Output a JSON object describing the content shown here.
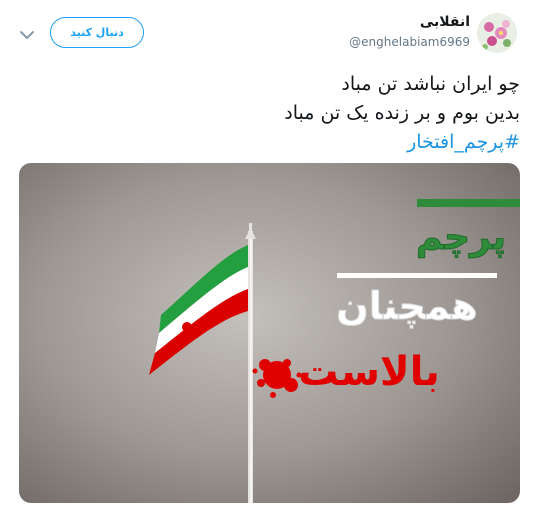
{
  "tweet": {
    "display_name": "انقلابی",
    "handle": "@enghelabiam6969",
    "follow_label": "دنبال کنید",
    "text_line1": "چو ایران نباشد تن مباد",
    "text_line2": "بدین بوم و بر زنده یک تن مباد",
    "hashtag": "#پرچم_افتخار"
  },
  "media": {
    "word1": "پرچم",
    "word2": "همچنان",
    "word3": "بالاست",
    "colors": {
      "green": "#2e8b3a",
      "white": "#ffffff",
      "red": "#e00000"
    }
  },
  "colors": {
    "accent": "#1DA1F2",
    "hashtag": "#1b95e0",
    "text": "#14171a",
    "muted": "#657786"
  },
  "icons": {
    "more": "chevron-down-icon"
  }
}
